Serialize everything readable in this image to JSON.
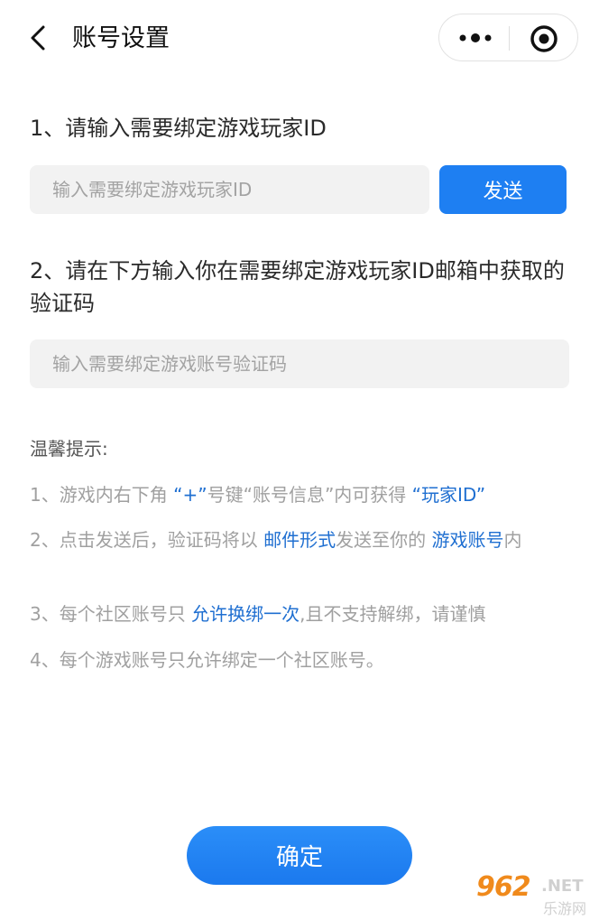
{
  "nav": {
    "title": "账号设置",
    "back_icon": "chevron-left-icon",
    "more_icon": "more-dots-icon",
    "close_icon": "target-circle-icon"
  },
  "step1": {
    "title": "1、请输入需要绑定游戏玩家ID",
    "placeholder": "输入需要绑定游戏玩家ID",
    "value": "",
    "send_label": "发送"
  },
  "step2": {
    "title": "2、请在下方输入你在需要绑定游戏玩家ID邮箱中获取的验证码",
    "placeholder": "输入需要绑定游戏账号验证码",
    "value": ""
  },
  "tips": {
    "title": "温馨提示:",
    "items": [
      {
        "a": "1、游戏内右下角 ",
        "b": "“+”",
        "c": "号键“账号信息”内可获得 ",
        "d": "“玩家ID”",
        "e": ""
      },
      {
        "a": "2、点击发送后，验证码将以 ",
        "b": "邮件形式",
        "c": "发送至你的 ",
        "d": "游戏账号",
        "e": "内"
      },
      {
        "a": "3、每个社区账号只 ",
        "b": "允许换绑一次",
        "c": ",且不支持解绑，请谨慎",
        "d": "",
        "e": ""
      },
      {
        "a": "4、每个游戏账号只允许绑定一个社区账号。",
        "b": "",
        "c": "",
        "d": "",
        "e": ""
      }
    ]
  },
  "confirm_label": "确定",
  "watermark": {
    "number": "962",
    "suffix": ".NET",
    "site": "乐游网"
  },
  "colors": {
    "primary": "#1e7ff2",
    "highlight": "#1f6fd1",
    "muted": "#a0a0a0",
    "input_bg": "#f2f2f2"
  }
}
